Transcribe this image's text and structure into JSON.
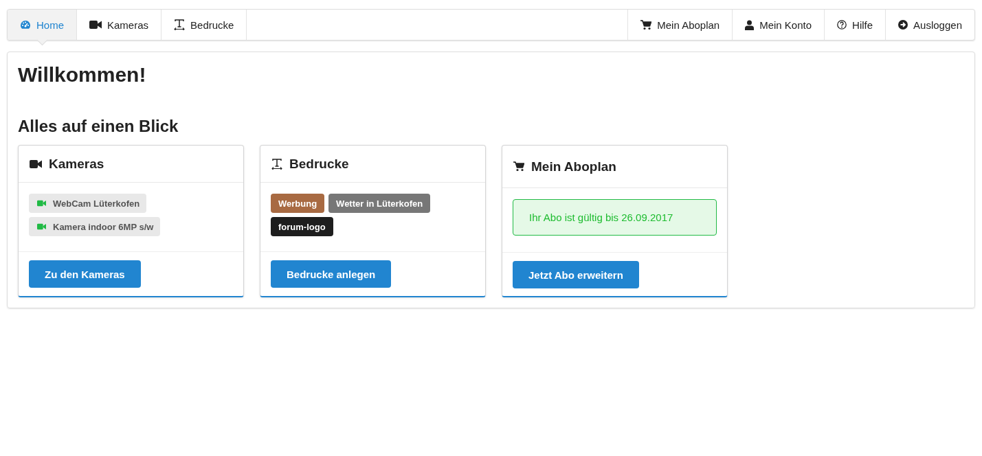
{
  "nav": {
    "left": [
      {
        "label": "Home",
        "kind": "gauge",
        "selected": true
      },
      {
        "label": "Kameras",
        "kind": "camera",
        "selected": false
      },
      {
        "label": "Bedrucke",
        "kind": "text",
        "selected": false
      }
    ],
    "right": [
      {
        "label": "Mein Aboplan",
        "kind": "cart",
        "selected": false
      },
      {
        "label": "Mein Konto",
        "kind": "user",
        "selected": false
      },
      {
        "label": "Hilfe",
        "kind": "help",
        "selected": false
      },
      {
        "label": "Ausloggen",
        "kind": "logout",
        "selected": false
      }
    ]
  },
  "heading": "Willkommen!",
  "subheading": "Alles auf einen Blick",
  "cards": [
    {
      "title": "Kameras",
      "kind": "cameras",
      "items": [
        {
          "label": "WebCam Lüterkofen",
          "online": true
        },
        {
          "label": "Kamera indoor 6MP s/w",
          "online": true
        }
      ],
      "button": "Zu den Kameras"
    },
    {
      "title": "Bedrucke",
      "kind": "tags",
      "tags": [
        {
          "label": "Werbung",
          "color": "#a86a42"
        },
        {
          "label": "Wetter in Lüterkofen",
          "color": "#777777"
        },
        {
          "label": "forum-logo",
          "color": "#1e1e1e"
        }
      ],
      "button": "Bedrucke anlegen"
    },
    {
      "title": "Mein Aboplan",
      "kind": "alert",
      "message": "Ihr Abo ist gültig bis 26.09.2017",
      "button": "Jetzt Abo erweitern"
    }
  ]
}
